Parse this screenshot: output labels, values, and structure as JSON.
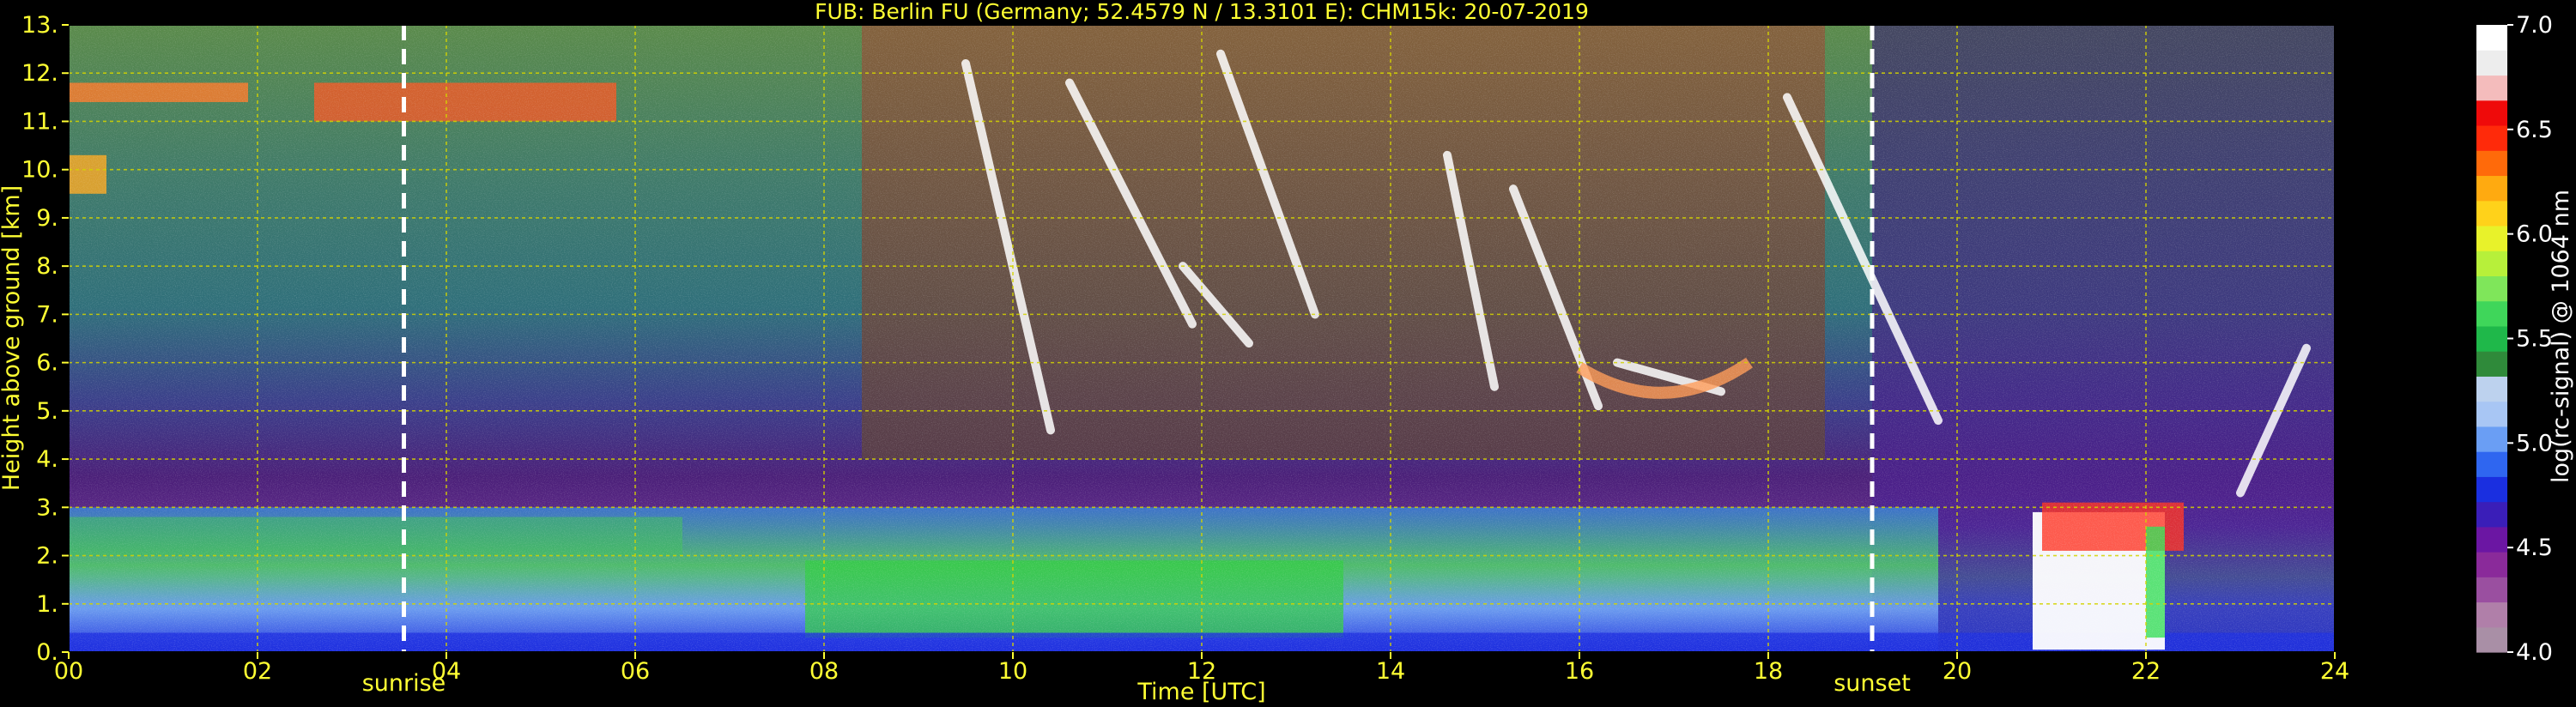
{
  "chart_data": {
    "type": "heatmap",
    "title": "FUB: Berlin FU (Germany; 52.4579 N / 13.3101 E):    CHM15k: 20-07-2019",
    "xlabel": "Time [UTC]",
    "ylabel": "Height above ground [km]",
    "colorbar_label": "log(rc-signal) @ 1064 nm",
    "xlim": [
      0,
      24
    ],
    "ylim": [
      0,
      13
    ],
    "clim": [
      4.0,
      7.0
    ],
    "x_ticks": [
      {
        "value": 0,
        "label": "00"
      },
      {
        "value": 2,
        "label": "02"
      },
      {
        "value": 4,
        "label": "04"
      },
      {
        "value": 6,
        "label": "06"
      },
      {
        "value": 8,
        "label": "08"
      },
      {
        "value": 10,
        "label": "10"
      },
      {
        "value": 12,
        "label": "12"
      },
      {
        "value": 14,
        "label": "14"
      },
      {
        "value": 16,
        "label": "16"
      },
      {
        "value": 18,
        "label": "18"
      },
      {
        "value": 20,
        "label": "20"
      },
      {
        "value": 22,
        "label": "22"
      },
      {
        "value": 24,
        "label": "24"
      }
    ],
    "y_ticks": [
      {
        "value": 0,
        "label": "0."
      },
      {
        "value": 1,
        "label": "1."
      },
      {
        "value": 2,
        "label": "2."
      },
      {
        "value": 3,
        "label": "3."
      },
      {
        "value": 4,
        "label": "4."
      },
      {
        "value": 5,
        "label": "5."
      },
      {
        "value": 6,
        "label": "6."
      },
      {
        "value": 7,
        "label": "7."
      },
      {
        "value": 8,
        "label": "8."
      },
      {
        "value": 9,
        "label": "9."
      },
      {
        "value": 10,
        "label": "10."
      },
      {
        "value": 11,
        "label": "11."
      },
      {
        "value": 12,
        "label": "12."
      },
      {
        "value": 13,
        "label": "13."
      }
    ],
    "colorbar_ticks": [
      {
        "value": 4.0,
        "label": "4.0"
      },
      {
        "value": 4.5,
        "label": "4.5"
      },
      {
        "value": 5.0,
        "label": "5.0"
      },
      {
        "value": 5.5,
        "label": "5.5"
      },
      {
        "value": 6.0,
        "label": "6.0"
      },
      {
        "value": 6.5,
        "label": "6.5"
      },
      {
        "value": 7.0,
        "label": "7.0"
      }
    ],
    "markers": [
      {
        "label": "sunrise",
        "x": 3.55
      },
      {
        "label": "sunset",
        "x": 19.1
      }
    ],
    "grid": true,
    "colormap": [
      "#a98fa6",
      "#b07fa9",
      "#9a4fa0",
      "#8a2a9a",
      "#6b16a3",
      "#3a1eb8",
      "#1a2fe0",
      "#2f66f0",
      "#6a9ef4",
      "#a8c6f4",
      "#bdd2ee",
      "#2f8a3a",
      "#1fb84a",
      "#3fd65a",
      "#7fe65a",
      "#b7f03a",
      "#e8f22a",
      "#ffd21a",
      "#ffaa10",
      "#ff6a0a",
      "#ff2a0a",
      "#ef0a0a",
      "#f4bcbc",
      "#ededed",
      "#ffffff"
    ],
    "colors": {
      "text": "#ffff33",
      "background": "#000000",
      "grid": "#d4d400",
      "marker": "#ffffff"
    }
  }
}
